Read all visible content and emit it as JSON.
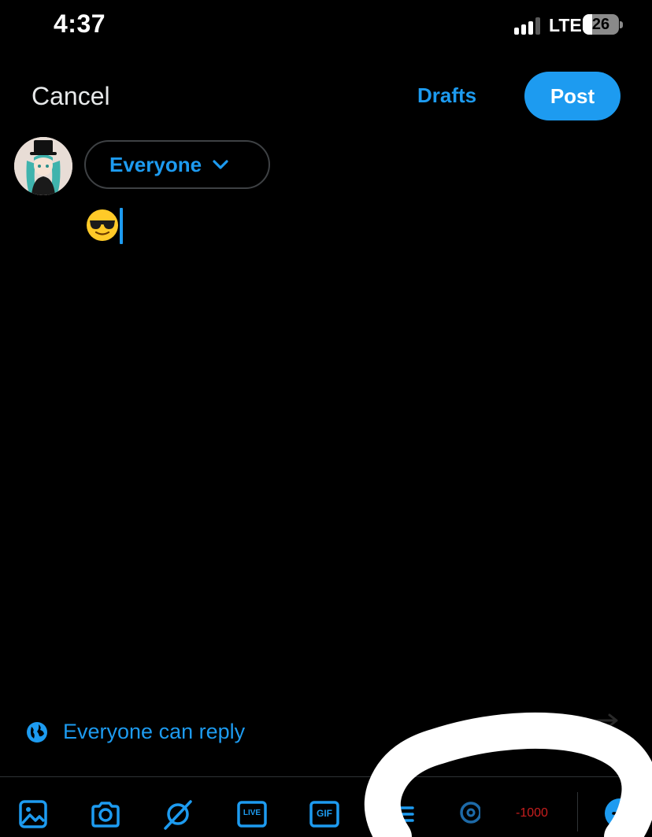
{
  "status_bar": {
    "time": "4:37",
    "network": "LTE",
    "battery": "26",
    "battery_fraction": 0.26
  },
  "header": {
    "cancel_label": "Cancel",
    "drafts_label": "Drafts",
    "post_label": "Post"
  },
  "composer": {
    "audience_label": "Everyone",
    "text_emoji": "smiling-face-with-sunglasses",
    "avatar": "user-avatar"
  },
  "reply_setting": {
    "label": "Everyone can reply",
    "icon": "globe-icon"
  },
  "toolbar": {
    "icons": [
      "image-icon",
      "camera-icon",
      "grok-icon",
      "live-icon",
      "gif-icon",
      "poll-icon",
      "location-icon"
    ],
    "live_label": "LIVE",
    "gif_label": "GIF",
    "char_count": "-1000",
    "add_icon": "add-thread-icon"
  },
  "colors": {
    "accent": "#1d9bf0",
    "background": "#000000",
    "over_limit": "#c81e1e",
    "divider": "#2f3336"
  }
}
